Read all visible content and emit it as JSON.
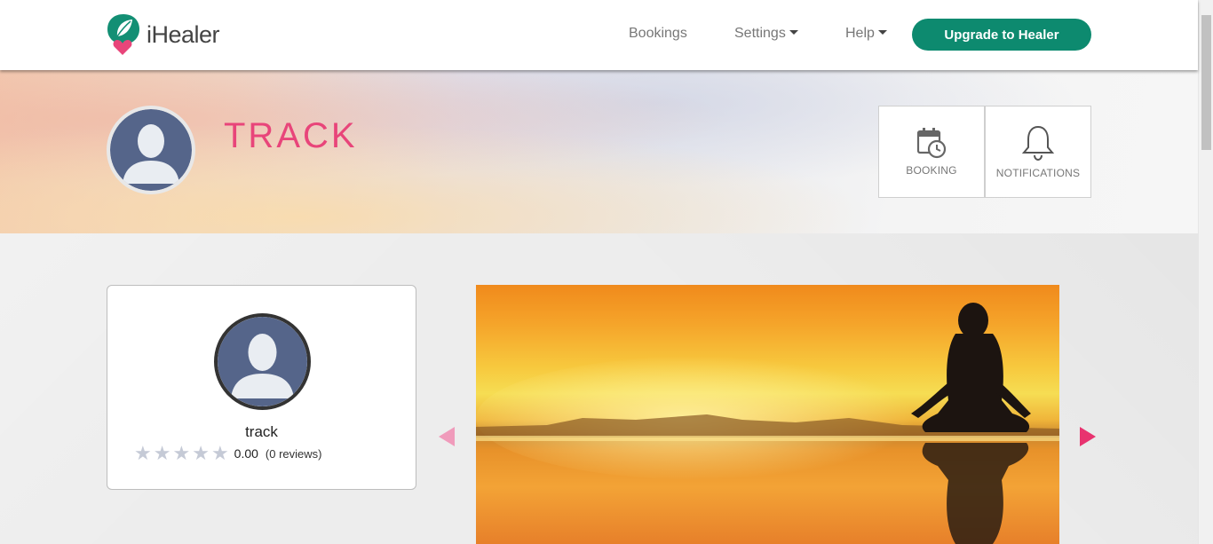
{
  "navbar": {
    "brand": "iHealer",
    "links": [
      {
        "label": "Bookings"
      },
      {
        "label": "Settings"
      },
      {
        "label": "Help"
      }
    ],
    "upgrade_label": "Upgrade to Healer"
  },
  "banner": {
    "display_name": "TRACK",
    "tiles": [
      {
        "label": "BOOKING",
        "icon": "calendar-clock-icon"
      },
      {
        "label": "NOTIFICATIONS",
        "icon": "bell-icon"
      }
    ]
  },
  "profile": {
    "name": "track",
    "rating_value": "0.00",
    "reviews": "(0 reviews)",
    "stars": 5
  },
  "carousel": {
    "slide_image": "meditation-sunset-photo"
  },
  "colors": {
    "brand_green": "#0d8a6f",
    "accent_pink": "#e8457a"
  }
}
